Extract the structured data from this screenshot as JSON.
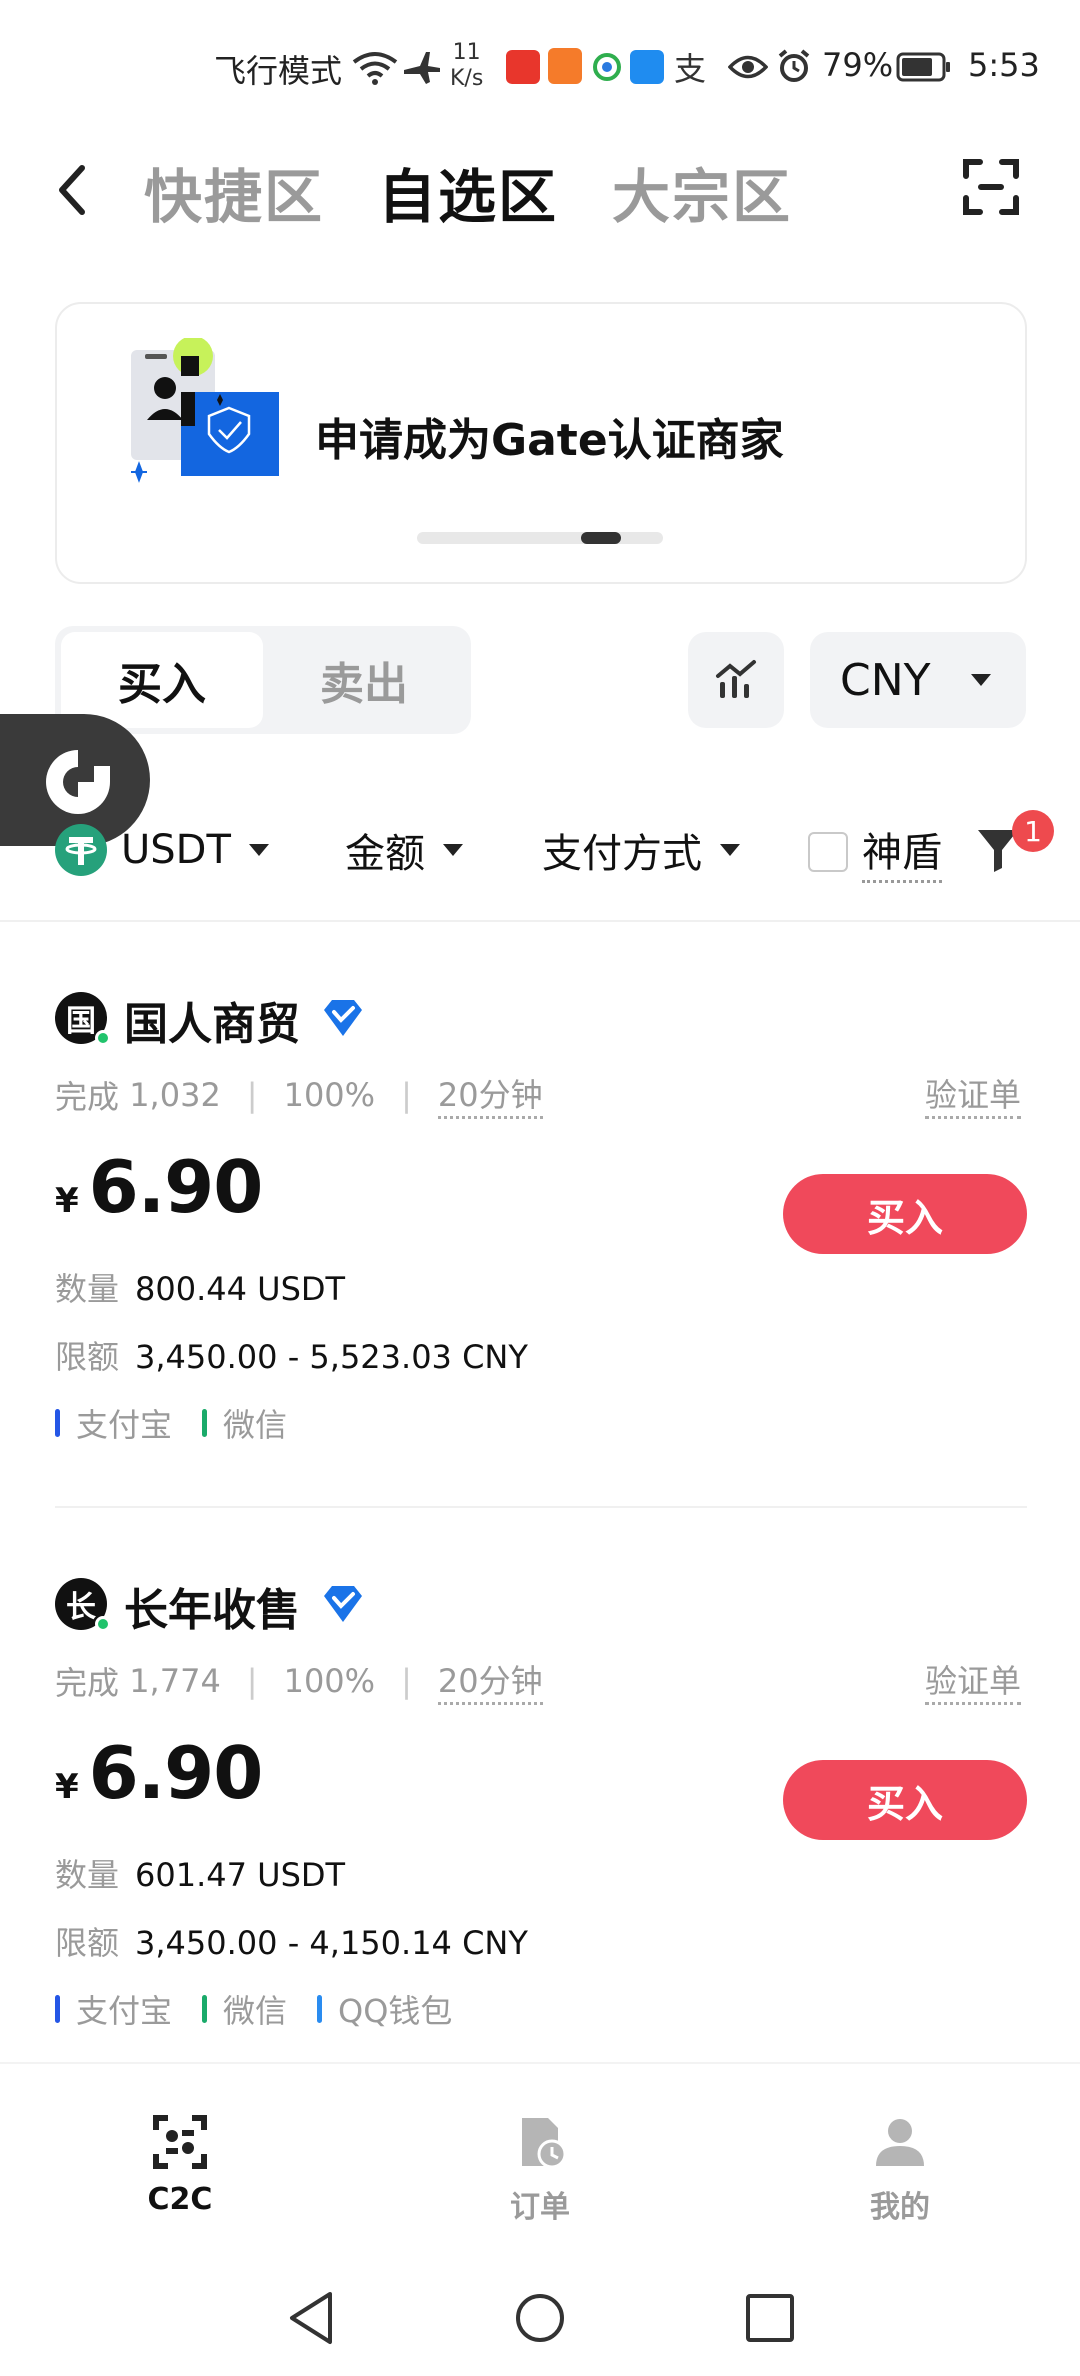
{
  "status_bar": {
    "airplane_text": "飞行模式",
    "speed_value": "11",
    "speed_unit": "K/s",
    "battery": "79%",
    "time": "5:53"
  },
  "nav": {
    "tabs": [
      {
        "label": "快捷区",
        "active": false
      },
      {
        "label": "自选区",
        "active": true
      },
      {
        "label": "大宗区",
        "active": false
      }
    ]
  },
  "banner": {
    "title": "申请成为Gate认证商家"
  },
  "trade": {
    "buy_label": "买入",
    "sell_label": "卖出",
    "currency": "CNY"
  },
  "filters": {
    "coin": "USDT",
    "amount": "金额",
    "payment": "支付方式",
    "shield": "神盾",
    "filter_badge": "1"
  },
  "listings": [
    {
      "avatar_char": "国",
      "name": "国人商贸",
      "completed_label": "完成",
      "completed_count": "1,032",
      "rate": "100%",
      "time": "20分钟",
      "verify_label": "验证单",
      "currency_symbol": "¥",
      "price": "6.90",
      "button": "买入",
      "qty_label": "数量",
      "qty": "800.44 USDT",
      "limit_label": "限额",
      "limit": "3,450.00 - 5,523.03 CNY",
      "payments": [
        {
          "name": "支付宝",
          "color": "#2456e6"
        },
        {
          "name": "微信",
          "color": "#1aaa6a"
        }
      ]
    },
    {
      "avatar_char": "长",
      "name": "长年收售",
      "completed_label": "完成",
      "completed_count": "1,774",
      "rate": "100%",
      "time": "20分钟",
      "verify_label": "验证单",
      "currency_symbol": "¥",
      "price": "6.90",
      "button": "买入",
      "qty_label": "数量",
      "qty": "601.47 USDT",
      "limit_label": "限额",
      "limit": "3,450.00 - 4,150.14 CNY",
      "payments": [
        {
          "name": "支付宝",
          "color": "#2456e6"
        },
        {
          "name": "微信",
          "color": "#1aaa6a"
        },
        {
          "name": "QQ钱包",
          "color": "#2a8cf0"
        }
      ]
    }
  ],
  "bottom_nav": [
    {
      "label": "C2C",
      "icon": "c2c-icon",
      "active": true
    },
    {
      "label": "订单",
      "icon": "order-icon",
      "active": false
    },
    {
      "label": "我的",
      "icon": "profile-icon",
      "active": false
    }
  ],
  "colors": {
    "accent_red": "#f0495b",
    "tether_green": "#26a17b",
    "verified_blue": "#1a73e8"
  }
}
